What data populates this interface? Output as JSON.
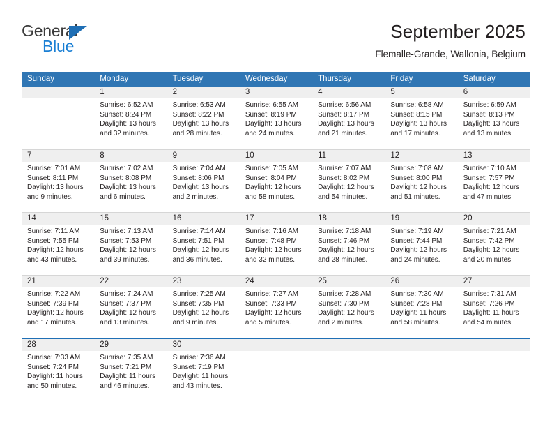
{
  "brand": {
    "name_top": "General",
    "name_bottom": "Blue",
    "triangle_color": "#1f6fb5",
    "blue_color": "#1a7fd4"
  },
  "header": {
    "title": "September 2025",
    "subtitle": "Flemalle-Grande, Wallonia, Belgium"
  },
  "theme": {
    "header_blue": "#3076b4",
    "rule_blue": "#1f6fb5",
    "date_band_gray": "#efefef",
    "grid_line": "#d6d6d6"
  },
  "weekdays": [
    "Sunday",
    "Monday",
    "Tuesday",
    "Wednesday",
    "Thursday",
    "Friday",
    "Saturday"
  ],
  "weeks": [
    {
      "days": [
        {
          "date": "",
          "sunrise": "",
          "sunset": "",
          "daylight": ""
        },
        {
          "date": "1",
          "sunrise": "Sunrise: 6:52 AM",
          "sunset": "Sunset: 8:24 PM",
          "daylight": "Daylight: 13 hours and 32 minutes."
        },
        {
          "date": "2",
          "sunrise": "Sunrise: 6:53 AM",
          "sunset": "Sunset: 8:22 PM",
          "daylight": "Daylight: 13 hours and 28 minutes."
        },
        {
          "date": "3",
          "sunrise": "Sunrise: 6:55 AM",
          "sunset": "Sunset: 8:19 PM",
          "daylight": "Daylight: 13 hours and 24 minutes."
        },
        {
          "date": "4",
          "sunrise": "Sunrise: 6:56 AM",
          "sunset": "Sunset: 8:17 PM",
          "daylight": "Daylight: 13 hours and 21 minutes."
        },
        {
          "date": "5",
          "sunrise": "Sunrise: 6:58 AM",
          "sunset": "Sunset: 8:15 PM",
          "daylight": "Daylight: 13 hours and 17 minutes."
        },
        {
          "date": "6",
          "sunrise": "Sunrise: 6:59 AM",
          "sunset": "Sunset: 8:13 PM",
          "daylight": "Daylight: 13 hours and 13 minutes."
        }
      ]
    },
    {
      "days": [
        {
          "date": "7",
          "sunrise": "Sunrise: 7:01 AM",
          "sunset": "Sunset: 8:11 PM",
          "daylight": "Daylight: 13 hours and 9 minutes."
        },
        {
          "date": "8",
          "sunrise": "Sunrise: 7:02 AM",
          "sunset": "Sunset: 8:08 PM",
          "daylight": "Daylight: 13 hours and 6 minutes."
        },
        {
          "date": "9",
          "sunrise": "Sunrise: 7:04 AM",
          "sunset": "Sunset: 8:06 PM",
          "daylight": "Daylight: 13 hours and 2 minutes."
        },
        {
          "date": "10",
          "sunrise": "Sunrise: 7:05 AM",
          "sunset": "Sunset: 8:04 PM",
          "daylight": "Daylight: 12 hours and 58 minutes."
        },
        {
          "date": "11",
          "sunrise": "Sunrise: 7:07 AM",
          "sunset": "Sunset: 8:02 PM",
          "daylight": "Daylight: 12 hours and 54 minutes."
        },
        {
          "date": "12",
          "sunrise": "Sunrise: 7:08 AM",
          "sunset": "Sunset: 8:00 PM",
          "daylight": "Daylight: 12 hours and 51 minutes."
        },
        {
          "date": "13",
          "sunrise": "Sunrise: 7:10 AM",
          "sunset": "Sunset: 7:57 PM",
          "daylight": "Daylight: 12 hours and 47 minutes."
        }
      ]
    },
    {
      "days": [
        {
          "date": "14",
          "sunrise": "Sunrise: 7:11 AM",
          "sunset": "Sunset: 7:55 PM",
          "daylight": "Daylight: 12 hours and 43 minutes."
        },
        {
          "date": "15",
          "sunrise": "Sunrise: 7:13 AM",
          "sunset": "Sunset: 7:53 PM",
          "daylight": "Daylight: 12 hours and 39 minutes."
        },
        {
          "date": "16",
          "sunrise": "Sunrise: 7:14 AM",
          "sunset": "Sunset: 7:51 PM",
          "daylight": "Daylight: 12 hours and 36 minutes."
        },
        {
          "date": "17",
          "sunrise": "Sunrise: 7:16 AM",
          "sunset": "Sunset: 7:48 PM",
          "daylight": "Daylight: 12 hours and 32 minutes."
        },
        {
          "date": "18",
          "sunrise": "Sunrise: 7:18 AM",
          "sunset": "Sunset: 7:46 PM",
          "daylight": "Daylight: 12 hours and 28 minutes."
        },
        {
          "date": "19",
          "sunrise": "Sunrise: 7:19 AM",
          "sunset": "Sunset: 7:44 PM",
          "daylight": "Daylight: 12 hours and 24 minutes."
        },
        {
          "date": "20",
          "sunrise": "Sunrise: 7:21 AM",
          "sunset": "Sunset: 7:42 PM",
          "daylight": "Daylight: 12 hours and 20 minutes."
        }
      ]
    },
    {
      "days": [
        {
          "date": "21",
          "sunrise": "Sunrise: 7:22 AM",
          "sunset": "Sunset: 7:39 PM",
          "daylight": "Daylight: 12 hours and 17 minutes."
        },
        {
          "date": "22",
          "sunrise": "Sunrise: 7:24 AM",
          "sunset": "Sunset: 7:37 PM",
          "daylight": "Daylight: 12 hours and 13 minutes."
        },
        {
          "date": "23",
          "sunrise": "Sunrise: 7:25 AM",
          "sunset": "Sunset: 7:35 PM",
          "daylight": "Daylight: 12 hours and 9 minutes."
        },
        {
          "date": "24",
          "sunrise": "Sunrise: 7:27 AM",
          "sunset": "Sunset: 7:33 PM",
          "daylight": "Daylight: 12 hours and 5 minutes."
        },
        {
          "date": "25",
          "sunrise": "Sunrise: 7:28 AM",
          "sunset": "Sunset: 7:30 PM",
          "daylight": "Daylight: 12 hours and 2 minutes."
        },
        {
          "date": "26",
          "sunrise": "Sunrise: 7:30 AM",
          "sunset": "Sunset: 7:28 PM",
          "daylight": "Daylight: 11 hours and 58 minutes."
        },
        {
          "date": "27",
          "sunrise": "Sunrise: 7:31 AM",
          "sunset": "Sunset: 7:26 PM",
          "daylight": "Daylight: 11 hours and 54 minutes."
        }
      ]
    },
    {
      "days": [
        {
          "date": "28",
          "sunrise": "Sunrise: 7:33 AM",
          "sunset": "Sunset: 7:24 PM",
          "daylight": "Daylight: 11 hours and 50 minutes."
        },
        {
          "date": "29",
          "sunrise": "Sunrise: 7:35 AM",
          "sunset": "Sunset: 7:21 PM",
          "daylight": "Daylight: 11 hours and 46 minutes."
        },
        {
          "date": "30",
          "sunrise": "Sunrise: 7:36 AM",
          "sunset": "Sunset: 7:19 PM",
          "daylight": "Daylight: 11 hours and 43 minutes."
        },
        {
          "date": "",
          "sunrise": "",
          "sunset": "",
          "daylight": ""
        },
        {
          "date": "",
          "sunrise": "",
          "sunset": "",
          "daylight": ""
        },
        {
          "date": "",
          "sunrise": "",
          "sunset": "",
          "daylight": ""
        },
        {
          "date": "",
          "sunrise": "",
          "sunset": "",
          "daylight": ""
        }
      ]
    }
  ]
}
